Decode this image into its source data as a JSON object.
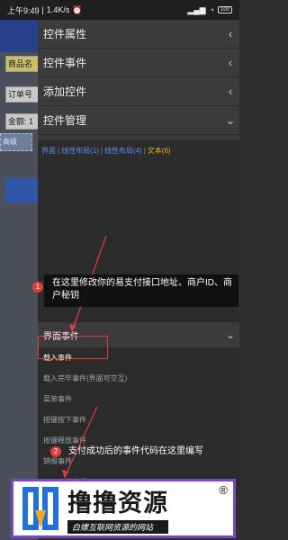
{
  "status_bar": {
    "time": "上午9:49",
    "speed": "1.4K/s",
    "battery": "100"
  },
  "background_app": {
    "fields": [
      "商品名",
      "订单号",
      "金额: 1"
    ],
    "tag": "高级"
  },
  "panel": {
    "sections": [
      {
        "label": "控件属性",
        "chevron": "‹"
      },
      {
        "label": "控件事件",
        "chevron": "‹"
      },
      {
        "label": "添加控件",
        "chevron": "‹"
      },
      {
        "label": "控件管理",
        "chevron": "⌄"
      }
    ],
    "breadcrumb": [
      "界面",
      "线性布局(1)",
      "线性布局(4)",
      "文本(6)"
    ],
    "events_header": "界面事件",
    "events": [
      "载入事件",
      "载入完毕事件(界面可交互)",
      "菜单事件",
      "按键按下事件",
      "按键释放事件",
      "销毁事件",
      "Stop... 件事件"
    ]
  },
  "annotations": {
    "note1_number": "1",
    "note1_text": "在这里修改你的易支付接口地址、商户ID、商户秘钥",
    "note2_number": "2",
    "note2_text": "支付成功后的事件代码在这里编写",
    "accent_color": "#e23b3b"
  },
  "watermark": {
    "title": "撸撸资源",
    "subtitle": "白嫖互联网资源的网站",
    "reg": "®"
  }
}
